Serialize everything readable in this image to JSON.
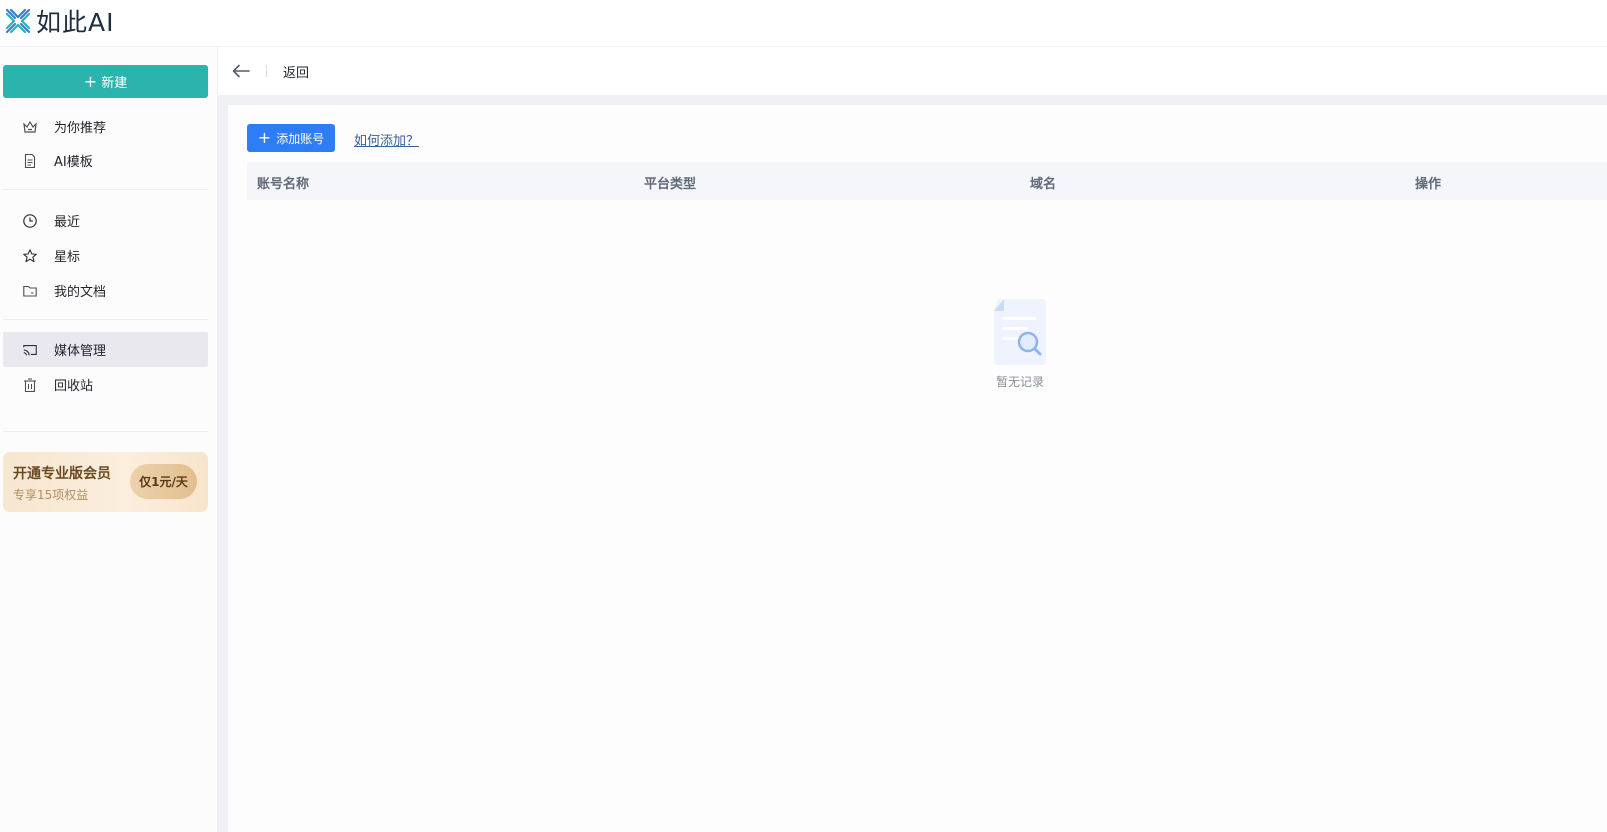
{
  "app": {
    "name": "如此AI"
  },
  "sidebar": {
    "new_button_label": "新建",
    "items": [
      {
        "label": "为你推荐",
        "icon": "crown-icon"
      },
      {
        "label": "AI模板",
        "icon": "document-icon"
      },
      {
        "label": "最近",
        "icon": "clock-icon"
      },
      {
        "label": "星标",
        "icon": "star-icon"
      },
      {
        "label": "我的文档",
        "icon": "folder-icon"
      },
      {
        "label": "媒体管理",
        "icon": "cast-icon",
        "active": true
      },
      {
        "label": "回收站",
        "icon": "trash-icon"
      }
    ],
    "promo": {
      "title": "开通专业版会员",
      "subtitle": "专享15项权益",
      "button_label": "仅1元/天"
    }
  },
  "main": {
    "back_label": "返回",
    "add_account_label": "添加账号",
    "how_to_add_label": "如何添加？",
    "table": {
      "columns": [
        "账号名称",
        "平台类型",
        "域名",
        "操作"
      ],
      "rows": []
    },
    "empty_text": "暂无记录"
  },
  "colors": {
    "brand_teal": "#2bb3ad",
    "primary_blue": "#2e7cf6",
    "active_item_bg": "#e8e8ee",
    "promo_bg": "#f7e6d0"
  }
}
